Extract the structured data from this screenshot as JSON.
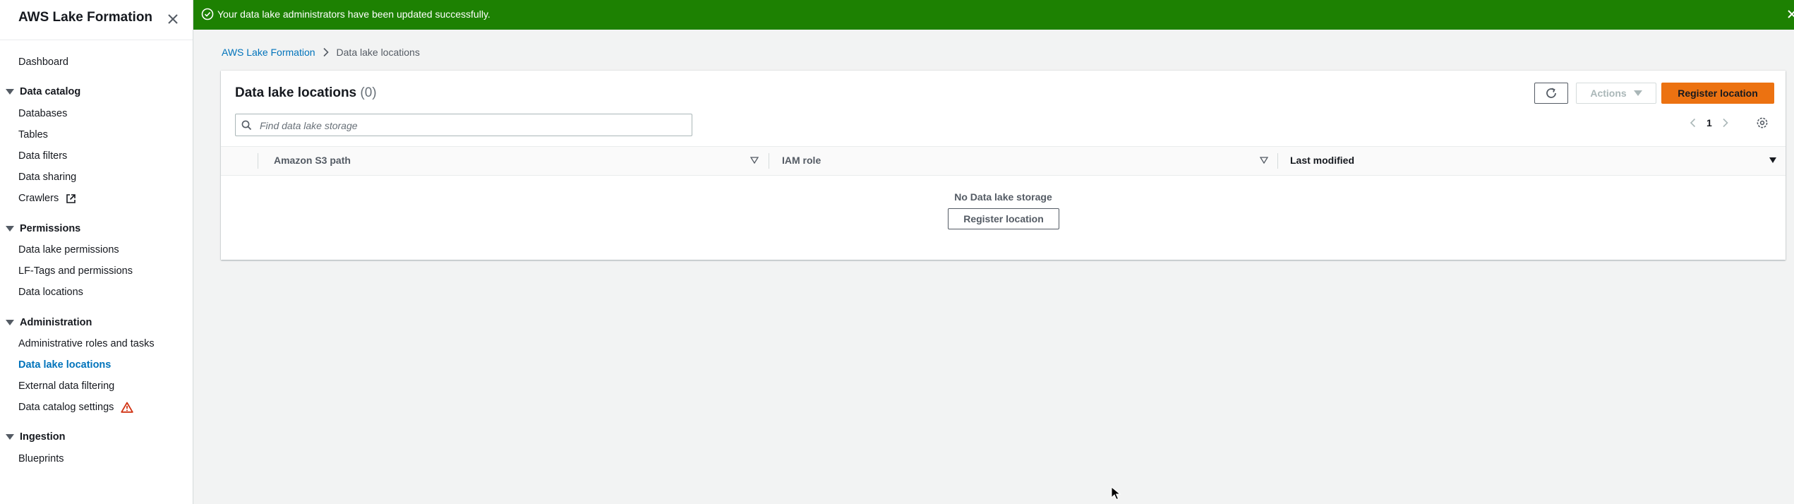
{
  "sidebar": {
    "title": "AWS Lake Formation",
    "items": {
      "dashboard": "Dashboard",
      "data_catalog": "Data catalog",
      "databases": "Databases",
      "tables": "Tables",
      "data_filters": "Data filters",
      "data_sharing": "Data sharing",
      "crawlers": "Crawlers",
      "permissions": "Permissions",
      "data_lake_permissions": "Data lake permissions",
      "lf_tags": "LF-Tags and permissions",
      "data_locations": "Data locations",
      "administration": "Administration",
      "admin_roles": "Administrative roles and tasks",
      "data_lake_locations": "Data lake locations",
      "external_filtering": "External data filtering",
      "catalog_settings": "Data catalog settings",
      "ingestion": "Ingestion",
      "blueprints": "Blueprints"
    }
  },
  "flash": {
    "message": "Your data lake administrators have been updated successfully."
  },
  "breadcrumb": {
    "root": "AWS Lake Formation",
    "current": "Data lake locations"
  },
  "table": {
    "title": "Data lake locations",
    "count": "(0)",
    "actions_label": "Actions",
    "register_label": "Register location",
    "search_placeholder": "Find data lake storage",
    "page": "1",
    "columns": [
      "Amazon S3 path",
      "IAM role",
      "Last modified"
    ],
    "empty_text": "No Data lake storage",
    "empty_button": "Register location"
  },
  "colors": {
    "accent": "#0073bb",
    "success": "#1d8102",
    "primary_button": "#ec7211",
    "warning": "#d13212"
  }
}
